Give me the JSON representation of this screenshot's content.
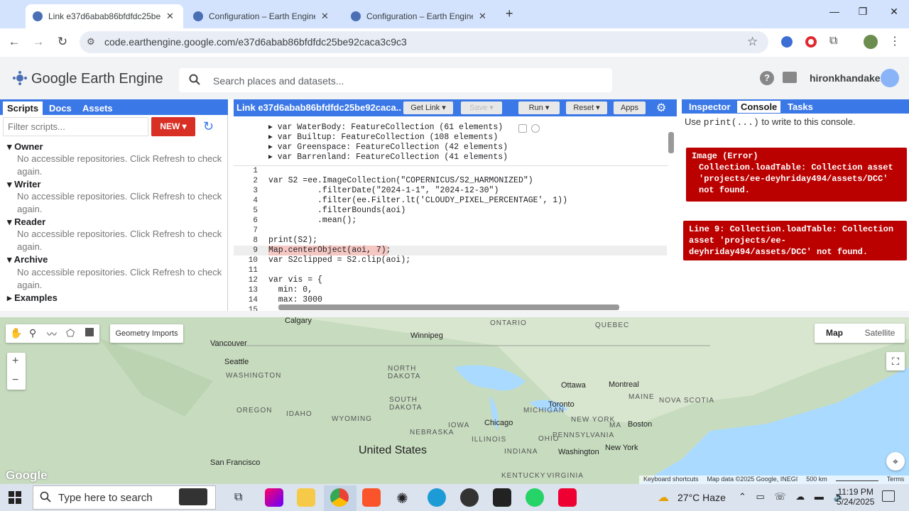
{
  "browser": {
    "tabs": [
      {
        "title": "Link e37d6abab86bfdfdc25be92caca3c9c3",
        "active": true
      },
      {
        "title": "Configuration – Earth Engine – Google",
        "active": false
      },
      {
        "title": "Configuration – Earth Engine – Google",
        "active": false
      }
    ],
    "new_tab": "+",
    "url": "code.earthengine.google.com/e37d6abab86bfdfdc25be92caca3c9c3"
  },
  "gee": {
    "logo": "Google Earth Engine",
    "search_placeholder": "Search places and datasets...",
    "username": "hironkhandaker"
  },
  "left_panel": {
    "tabs": [
      "Scripts",
      "Docs",
      "Assets"
    ],
    "filter_placeholder": "Filter scripts...",
    "new_label": "NEW",
    "groups": [
      {
        "name": "Owner",
        "message": "No accessible repositories. Click Refresh to check again."
      },
      {
        "name": "Writer",
        "message": "No accessible repositories. Click Refresh to check again."
      },
      {
        "name": "Reader",
        "message": "No accessible repositories. Click Refresh to check again."
      },
      {
        "name": "Archive",
        "message": "No accessible repositories. Click Refresh to check again."
      },
      {
        "name": "Examples",
        "message": ""
      }
    ]
  },
  "editor": {
    "title": "Link e37d6abab86bfdfdc25be92caca...",
    "buttons": {
      "get_link": "Get Link",
      "save": "Save",
      "run": "Run",
      "reset": "Reset",
      "apps": "Apps"
    },
    "imports": [
      "var WaterBody: FeatureCollection (61 elements)",
      "var Builtup: FeatureCollection (108 elements)",
      "var Greenspace: FeatureCollection (42 elements)",
      "var Barrenland: FeatureCollection (41 elements)"
    ],
    "line_numbers": [
      "1",
      "2",
      "3",
      "4",
      "5",
      "6",
      "7",
      "8",
      "9",
      "10",
      "11",
      "12",
      "13",
      "14",
      "15"
    ],
    "lines": [
      "",
      "var S2 =ee.ImageCollection(\"COPERNICUS/S2_HARMONIZED\")",
      "          .filterDate(\"2024-1-1\", \"2024-12-30\")",
      "          .filter(ee.Filter.lt('CLOUDY_PIXEL_PERCENTAGE', 1))",
      "          .filterBounds(aoi)",
      "          .mean();",
      "",
      "print(S2);",
      "Map.centerObject(aoi, 7);",
      "var S2clipped = S2.clip(aoi);",
      "",
      "var vis = {",
      "  min: 0,",
      "  max: 3000",
      ""
    ]
  },
  "right_panel": {
    "tabs": [
      "Inspector",
      "Console",
      "Tasks"
    ],
    "hint_pre": "Use ",
    "hint_code": "print(...)",
    "hint_post": " to write to this console.",
    "errors": [
      {
        "head": "Image (Error)",
        "body": "Collection.loadTable: Collection asset 'projects/ee-deyhriday494/assets/DCC' not found."
      },
      {
        "head": "",
        "body": "Line 9: Collection.loadTable: Collection asset 'projects/ee-deyhriday494/assets/DCC' not found."
      }
    ]
  },
  "map": {
    "geometry_imports": "Geometry Imports",
    "map_type_map": "Map",
    "map_type_satellite": "Satellite",
    "zoom_in": "+",
    "zoom_out": "−",
    "google_logo": "Google",
    "attribution": [
      "Keyboard shortcuts",
      "Map data ©2025 Google, INEGI",
      "500 km",
      "Terms"
    ],
    "regions": [
      "ONTARIO",
      "QUEBEC",
      "NORTH DAKOTA",
      "SOUTH DAKOTA",
      "WASHINGTON",
      "OREGON",
      "IDAHO",
      "WYOMING",
      "NEBRASKA",
      "MICHIGAN",
      "IOWA",
      "ILLINOIS",
      "INDIANA",
      "OHIO",
      "MAINE",
      "NOVA SCOTIA",
      "NEW YORK",
      "PENNSYLVANIA",
      "KENTUCKY",
      "VIRGINIA",
      "MA"
    ],
    "cities": [
      "Calgary",
      "Winnipeg",
      "Vancouver",
      "Seattle",
      "Ottawa",
      "Montreal",
      "Toronto",
      "Chicago",
      "Boston",
      "New York",
      "Washington",
      "San Francisco"
    ],
    "country": "United States"
  },
  "taskbar": {
    "search": "Type here to search",
    "weather": "27°C  Haze",
    "time": "11:19 PM",
    "date": "5/24/2025"
  },
  "colors": {
    "gee_blue": "#3b78e7",
    "error_red": "#b00000",
    "new_red": "#d93025"
  }
}
